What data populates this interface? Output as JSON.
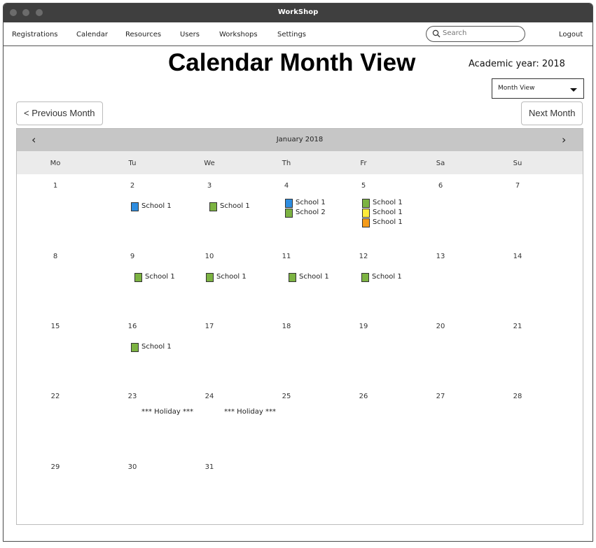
{
  "window": {
    "title": "WorkShop"
  },
  "nav": {
    "items": [
      {
        "label": "Registrations"
      },
      {
        "label": "Calendar"
      },
      {
        "label": "Resources"
      },
      {
        "label": "Users"
      },
      {
        "label": "Workshops"
      },
      {
        "label": "Settings"
      }
    ],
    "search_placeholder": "Search",
    "logout": "Logout"
  },
  "page": {
    "title": "Calendar Month View",
    "academic_year": "Academic year: 2018",
    "view_select": "Month View",
    "prev_button": "< Previous Month",
    "next_button": "Next Month"
  },
  "calendar": {
    "month": "January 2018",
    "prev_icon": "chevron-left-icon",
    "next_icon": "chevron-right-icon",
    "weekdays": [
      "Mo",
      "Tu",
      "We",
      "Th",
      "Fr",
      "Sa",
      "Su"
    ],
    "days": [
      "1",
      "2",
      "3",
      "4",
      "5",
      "6",
      "7",
      "8",
      "9",
      "10",
      "11",
      "12",
      "13",
      "14",
      "15",
      "16",
      "17",
      "18",
      "19",
      "20",
      "21",
      "22",
      "23",
      "24",
      "25",
      "26",
      "27",
      "28",
      "29",
      "30",
      "31"
    ],
    "events": [
      {
        "day": "2",
        "label": "School 1",
        "color": "#2e8de0"
      },
      {
        "day": "3",
        "label": "School 1",
        "color": "#7cb342"
      },
      {
        "day": "4",
        "label": "School 1",
        "color": "#2e8de0"
      },
      {
        "day": "4",
        "label": "School 2",
        "color": "#7cb342"
      },
      {
        "day": "5",
        "label": "School 1",
        "color": "#7cb342"
      },
      {
        "day": "5",
        "label": "School 1",
        "color": "#ffeb3b"
      },
      {
        "day": "5",
        "label": "School 1",
        "color": "#f59c1a"
      },
      {
        "day": "9",
        "label": "School 1",
        "color": "#7cb342"
      },
      {
        "day": "10",
        "label": "School 1",
        "color": "#7cb342"
      },
      {
        "day": "11",
        "label": "School 1",
        "color": "#7cb342"
      },
      {
        "day": "12",
        "label": "School 1",
        "color": "#7cb342"
      },
      {
        "day": "16",
        "label": "School 1",
        "color": "#7cb342"
      }
    ],
    "holidays": [
      {
        "day": "23",
        "label": "*** Holiday ***"
      },
      {
        "day": "24",
        "label": "*** Holiday ***"
      }
    ]
  }
}
